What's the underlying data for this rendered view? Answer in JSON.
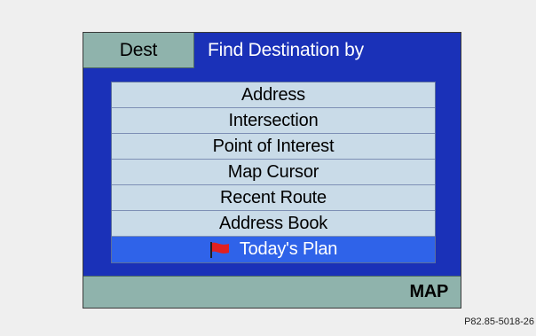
{
  "window": {
    "tab_label": "Dest",
    "title": "Find Destination by"
  },
  "menu": {
    "items": [
      {
        "label": "Address"
      },
      {
        "label": "Intersection"
      },
      {
        "label": "Point of Interest"
      },
      {
        "label": "Map Cursor"
      },
      {
        "label": "Recent Route"
      },
      {
        "label": "Address Book"
      },
      {
        "label": "Today's Plan",
        "icon": "flag-icon",
        "selected": true
      }
    ]
  },
  "bottom_bar": {
    "map_label": "MAP"
  },
  "figure_code": "P82.85-5018-26",
  "colors": {
    "screen_bg": "#1a31b8",
    "tab_bg": "#8fb3ac",
    "item_bg": "#c9dbe8",
    "selected_bg": "#2f63e9",
    "flag": "#e02020"
  }
}
